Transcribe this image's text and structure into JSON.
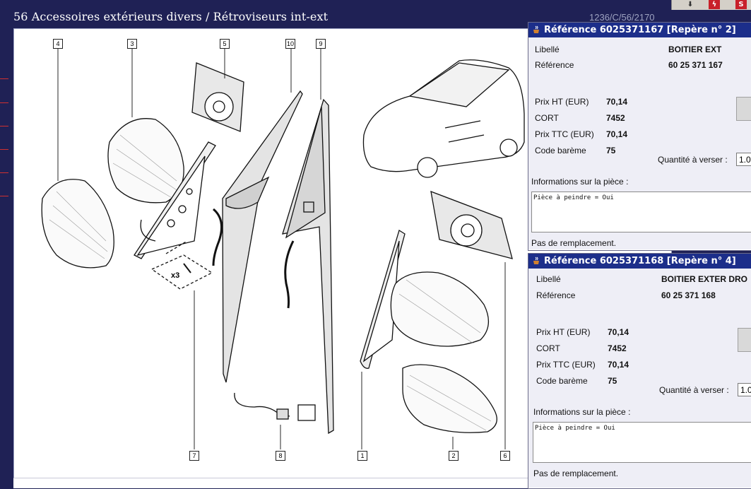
{
  "page": {
    "title": "56 Accessoires extérieurs divers / Rétroviseurs int-ext",
    "code": "1236/C/56/2170"
  },
  "toolbar": {
    "icons": [
      "download-icon",
      "flash-icon",
      "s-icon"
    ]
  },
  "diagram": {
    "callouts": [
      "4",
      "3",
      "5",
      "10",
      "9",
      "7",
      "8",
      "1",
      "2",
      "6"
    ],
    "screw_label": "x3"
  },
  "ref1": {
    "title": "Référence 6025371167 [Repère n° 2]",
    "libelle_label": "Libellé",
    "libelle_value": "BOITIER EXT",
    "reference_label": "Référence",
    "reference_value": "60 25 371 167",
    "prix_ht_label": "Prix HT (EUR)",
    "prix_ht_value": "70,14",
    "cort_label": "CORT",
    "cort_value": "7452",
    "prix_ttc_label": "Prix TTC (EUR)",
    "prix_ttc_value": "70,14",
    "code_bareme_label": "Code barème",
    "code_bareme_value": "75",
    "quantite_label": "Quantité à verser :",
    "quantite_value": "1.0",
    "info_label": "Informations sur la pièce :",
    "info_text": "Pièce à peindre  = Oui",
    "remplacement": "Pas de remplacement."
  },
  "ref2": {
    "title": "Référence 6025371168 [Repère n° 4]",
    "libelle_label": "Libellé",
    "libelle_value": "BOITIER EXTER DRO",
    "reference_label": "Référence",
    "reference_value": "60 25 371 168",
    "prix_ht_label": "Prix HT (EUR)",
    "prix_ht_value": "70,14",
    "cort_label": "CORT",
    "cort_value": "7452",
    "prix_ttc_label": "Prix TTC (EUR)",
    "prix_ttc_value": "70,14",
    "code_bareme_label": "Code barème",
    "code_bareme_value": "75",
    "quantite_label": "Quantité à verser :",
    "quantite_value": "1.0",
    "info_label": "Informations sur la pièce :",
    "info_text": "Pièce à peindre  = Oui",
    "remplacement": "Pas de remplacement."
  }
}
